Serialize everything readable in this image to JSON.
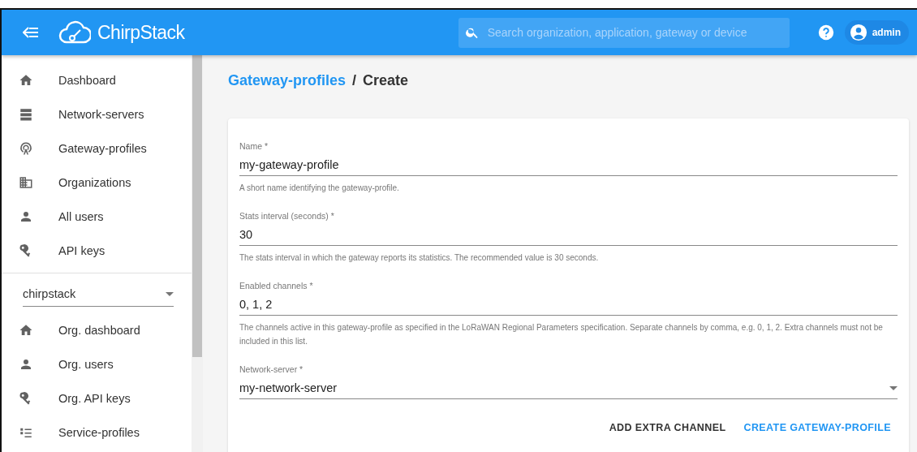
{
  "header": {
    "brand": "ChirpStack",
    "search": {
      "placeholder": "Search organization, application, gateway or device"
    },
    "user": "admin"
  },
  "sidebar": {
    "items": [
      {
        "label": "Dashboard",
        "selected": false
      },
      {
        "label": "Network-servers",
        "selected": false
      },
      {
        "label": "Gateway-profiles",
        "selected": false
      },
      {
        "label": "Organizations",
        "selected": false
      },
      {
        "label": "All users",
        "selected": false
      },
      {
        "label": "API keys",
        "selected": false
      }
    ],
    "organization": "chirpstack",
    "org_items": [
      {
        "label": "Org. dashboard",
        "selected": false
      },
      {
        "label": "Org. users",
        "selected": false
      },
      {
        "label": "Org. API keys",
        "selected": false
      },
      {
        "label": "Service-profiles",
        "selected": false
      }
    ]
  },
  "breadcrumb": {
    "link": "Gateway-profiles",
    "separator": "/",
    "current": "Create"
  },
  "form": {
    "fields": [
      {
        "kind": "text",
        "label": "Name *",
        "value": "my-gateway-profile",
        "help": "A short name identifying the gateway-profile."
      },
      {
        "kind": "text",
        "label": "Stats interval (seconds) *",
        "value": "30",
        "help": "The stats interval in which the gateway reports its statistics. The recommended value is 30 seconds."
      },
      {
        "kind": "text",
        "label": "Enabled channels *",
        "value": "0, 1, 2",
        "help": "The channels active in this gateway-profile as specified in the LoRaWAN Regional Parameters specification. Separate channels by comma, e.g. 0, 1, 2. Extra channels must not be included in this list."
      },
      {
        "kind": "select",
        "label": "Network-server *",
        "value": "my-network-server"
      }
    ],
    "buttons": [
      {
        "label": "ADD EXTRA CHANNEL",
        "kind": "secondary"
      },
      {
        "label": "CREATE GATEWAY-PROFILE",
        "kind": "primary"
      }
    ]
  }
}
